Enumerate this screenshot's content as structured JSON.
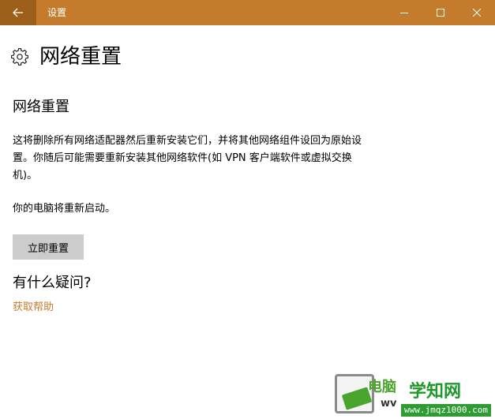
{
  "window": {
    "title": "设置",
    "accent_color": "#c47c2c",
    "controls": [
      {
        "icon": "minimize-icon"
      },
      {
        "icon": "maximize-icon"
      },
      {
        "icon": "close-icon"
      }
    ]
  },
  "header": {
    "icon": "gear-icon",
    "title": "网络重置"
  },
  "content": {
    "section_heading": "网络重置",
    "description": "这将删除所有网络适配器然后重新安装它们，并将其他网络组件设回为原始设置。你随后可能需要重新安装其他网络软件(如 VPN 客户端软件或虚拟交换机)。",
    "restart_note": "你的电脑将重新启动。",
    "reset_button": "立即重置",
    "question_heading": "有什么疑问?",
    "help_link": "获取帮助"
  },
  "watermark": {
    "brand": "电脑",
    "main": "学知网",
    "prefix": "wv",
    "url": "www.jmqz1000.com"
  }
}
